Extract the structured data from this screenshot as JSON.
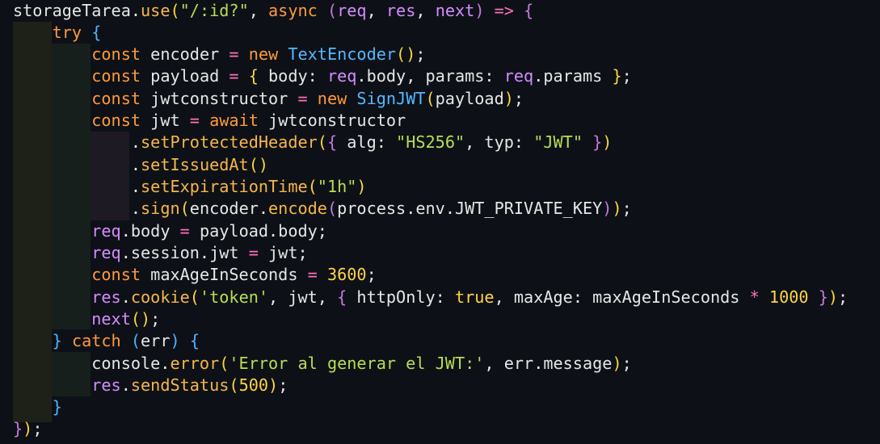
{
  "editor": {
    "language": "javascript",
    "theme_colors": {
      "background": "#0d1117",
      "keyword": "#ff9a3c",
      "function": "#f7b64a",
      "class": "#56b7ff",
      "string": "#b9dd55",
      "number": "#ffd34a",
      "variable": "#d58cff",
      "operator": "#ff6fb7",
      "text": "#e6e6e6"
    },
    "lines": [
      [
        {
          "t": "storageTarea",
          "c": "tx"
        },
        {
          "t": ".",
          "c": "tx"
        },
        {
          "t": "use",
          "c": "fn"
        },
        {
          "t": "(",
          "c": "p1"
        },
        {
          "t": "\"/:id?\"",
          "c": "str"
        },
        {
          "t": ", ",
          "c": "tx"
        },
        {
          "t": "async",
          "c": "kw"
        },
        {
          "t": " ",
          "c": "tx"
        },
        {
          "t": "(",
          "c": "p2"
        },
        {
          "t": "req",
          "c": "var"
        },
        {
          "t": ", ",
          "c": "tx"
        },
        {
          "t": "res",
          "c": "var"
        },
        {
          "t": ", ",
          "c": "tx"
        },
        {
          "t": "next",
          "c": "var"
        },
        {
          "t": ")",
          "c": "p2"
        },
        {
          "t": " => ",
          "c": "op"
        },
        {
          "t": "{",
          "c": "p2"
        }
      ],
      [
        {
          "t": "    ",
          "c": "tx"
        },
        {
          "t": "try",
          "c": "kw"
        },
        {
          "t": " ",
          "c": "tx"
        },
        {
          "t": "{",
          "c": "p3"
        }
      ],
      [
        {
          "t": "        ",
          "c": "tx"
        },
        {
          "t": "const",
          "c": "kw"
        },
        {
          "t": " encoder ",
          "c": "tx"
        },
        {
          "t": "=",
          "c": "op"
        },
        {
          "t": " ",
          "c": "tx"
        },
        {
          "t": "new",
          "c": "kw"
        },
        {
          "t": " ",
          "c": "tx"
        },
        {
          "t": "TextEncoder",
          "c": "cls"
        },
        {
          "t": "()",
          "c": "p1"
        },
        {
          "t": ";",
          "c": "tx"
        }
      ],
      [
        {
          "t": "        ",
          "c": "tx"
        },
        {
          "t": "const",
          "c": "kw"
        },
        {
          "t": " payload ",
          "c": "tx"
        },
        {
          "t": "=",
          "c": "op"
        },
        {
          "t": " ",
          "c": "tx"
        },
        {
          "t": "{",
          "c": "p1"
        },
        {
          "t": " body: ",
          "c": "tx"
        },
        {
          "t": "req",
          "c": "var"
        },
        {
          "t": ".body, params: ",
          "c": "tx"
        },
        {
          "t": "req",
          "c": "var"
        },
        {
          "t": ".params ",
          "c": "tx"
        },
        {
          "t": "}",
          "c": "p1"
        },
        {
          "t": ";",
          "c": "tx"
        }
      ],
      [
        {
          "t": "        ",
          "c": "tx"
        },
        {
          "t": "const",
          "c": "kw"
        },
        {
          "t": " jwtconstructor ",
          "c": "tx"
        },
        {
          "t": "=",
          "c": "op"
        },
        {
          "t": " ",
          "c": "tx"
        },
        {
          "t": "new",
          "c": "kw"
        },
        {
          "t": " ",
          "c": "tx"
        },
        {
          "t": "SignJWT",
          "c": "cls"
        },
        {
          "t": "(",
          "c": "p1"
        },
        {
          "t": "payload",
          "c": "tx"
        },
        {
          "t": ")",
          "c": "p1"
        },
        {
          "t": ";",
          "c": "tx"
        }
      ],
      [
        {
          "t": "        ",
          "c": "tx"
        },
        {
          "t": "const",
          "c": "kw"
        },
        {
          "t": " jwt ",
          "c": "tx"
        },
        {
          "t": "=",
          "c": "op"
        },
        {
          "t": " ",
          "c": "tx"
        },
        {
          "t": "await",
          "c": "kw"
        },
        {
          "t": " jwtconstructor",
          "c": "tx"
        }
      ],
      [
        {
          "t": "            ",
          "c": "tx"
        },
        {
          "t": ".",
          "c": "tx"
        },
        {
          "t": "setProtectedHeader",
          "c": "fn"
        },
        {
          "t": "(",
          "c": "p1"
        },
        {
          "t": "{",
          "c": "p2"
        },
        {
          "t": " alg: ",
          "c": "tx"
        },
        {
          "t": "\"HS256\"",
          "c": "str"
        },
        {
          "t": ", typ: ",
          "c": "tx"
        },
        {
          "t": "\"JWT\"",
          "c": "str"
        },
        {
          "t": " ",
          "c": "tx"
        },
        {
          "t": "}",
          "c": "p2"
        },
        {
          "t": ")",
          "c": "p1"
        }
      ],
      [
        {
          "t": "            ",
          "c": "tx"
        },
        {
          "t": ".",
          "c": "tx"
        },
        {
          "t": "setIssuedAt",
          "c": "fn"
        },
        {
          "t": "()",
          "c": "p1"
        }
      ],
      [
        {
          "t": "            ",
          "c": "tx"
        },
        {
          "t": ".",
          "c": "tx"
        },
        {
          "t": "setExpirationTime",
          "c": "fn"
        },
        {
          "t": "(",
          "c": "p1"
        },
        {
          "t": "\"1h\"",
          "c": "str"
        },
        {
          "t": ")",
          "c": "p1"
        }
      ],
      [
        {
          "t": "            ",
          "c": "tx"
        },
        {
          "t": ".",
          "c": "tx"
        },
        {
          "t": "sign",
          "c": "fn"
        },
        {
          "t": "(",
          "c": "p1"
        },
        {
          "t": "encoder.",
          "c": "tx"
        },
        {
          "t": "encode",
          "c": "fn"
        },
        {
          "t": "(",
          "c": "p2"
        },
        {
          "t": "process.env.JWT_PRIVATE_KEY",
          "c": "tx"
        },
        {
          "t": ")",
          "c": "p2"
        },
        {
          "t": ")",
          "c": "p1"
        },
        {
          "t": ";",
          "c": "tx"
        }
      ],
      [
        {
          "t": "        ",
          "c": "tx"
        },
        {
          "t": "req",
          "c": "var"
        },
        {
          "t": ".body ",
          "c": "tx"
        },
        {
          "t": "=",
          "c": "op"
        },
        {
          "t": " payload.body;",
          "c": "tx"
        }
      ],
      [
        {
          "t": "        ",
          "c": "tx"
        },
        {
          "t": "req",
          "c": "var"
        },
        {
          "t": ".session.jwt ",
          "c": "tx"
        },
        {
          "t": "=",
          "c": "op"
        },
        {
          "t": " jwt;",
          "c": "tx"
        }
      ],
      [
        {
          "t": "        ",
          "c": "tx"
        },
        {
          "t": "const",
          "c": "kw"
        },
        {
          "t": " maxAgeInSeconds ",
          "c": "tx"
        },
        {
          "t": "=",
          "c": "op"
        },
        {
          "t": " ",
          "c": "tx"
        },
        {
          "t": "3600",
          "c": "num"
        },
        {
          "t": ";",
          "c": "tx"
        }
      ],
      [
        {
          "t": "        ",
          "c": "tx"
        },
        {
          "t": "res",
          "c": "var"
        },
        {
          "t": ".",
          "c": "tx"
        },
        {
          "t": "cookie",
          "c": "fn"
        },
        {
          "t": "(",
          "c": "p1"
        },
        {
          "t": "'token'",
          "c": "str"
        },
        {
          "t": ", jwt, ",
          "c": "tx"
        },
        {
          "t": "{",
          "c": "p2"
        },
        {
          "t": " httpOnly: ",
          "c": "tx"
        },
        {
          "t": "true",
          "c": "num"
        },
        {
          "t": ", maxAge: maxAgeInSeconds ",
          "c": "tx"
        },
        {
          "t": "*",
          "c": "op"
        },
        {
          "t": " ",
          "c": "tx"
        },
        {
          "t": "1000",
          "c": "num"
        },
        {
          "t": " ",
          "c": "tx"
        },
        {
          "t": "}",
          "c": "p2"
        },
        {
          "t": ")",
          "c": "p1"
        },
        {
          "t": ";",
          "c": "tx"
        }
      ],
      [
        {
          "t": "        ",
          "c": "tx"
        },
        {
          "t": "next",
          "c": "var"
        },
        {
          "t": "()",
          "c": "p1"
        },
        {
          "t": ";",
          "c": "tx"
        }
      ],
      [
        {
          "t": "    ",
          "c": "tx"
        },
        {
          "t": "}",
          "c": "p3"
        },
        {
          "t": " ",
          "c": "tx"
        },
        {
          "t": "catch",
          "c": "kw"
        },
        {
          "t": " ",
          "c": "tx"
        },
        {
          "t": "(",
          "c": "p3"
        },
        {
          "t": "err",
          "c": "tx"
        },
        {
          "t": ")",
          "c": "p3"
        },
        {
          "t": " ",
          "c": "tx"
        },
        {
          "t": "{",
          "c": "p3"
        }
      ],
      [
        {
          "t": "        ",
          "c": "tx"
        },
        {
          "t": "console.",
          "c": "tx"
        },
        {
          "t": "error",
          "c": "fn"
        },
        {
          "t": "(",
          "c": "p1"
        },
        {
          "t": "'Error al generar el JWT:'",
          "c": "str"
        },
        {
          "t": ", err.message",
          "c": "tx"
        },
        {
          "t": ")",
          "c": "p1"
        },
        {
          "t": ";",
          "c": "tx"
        }
      ],
      [
        {
          "t": "        ",
          "c": "tx"
        },
        {
          "t": "res",
          "c": "var"
        },
        {
          "t": ".",
          "c": "tx"
        },
        {
          "t": "sendStatus",
          "c": "fn"
        },
        {
          "t": "(",
          "c": "p1"
        },
        {
          "t": "500",
          "c": "num"
        },
        {
          "t": ")",
          "c": "p1"
        },
        {
          "t": ";",
          "c": "tx"
        }
      ],
      [
        {
          "t": "    ",
          "c": "tx"
        },
        {
          "t": "}",
          "c": "p3"
        }
      ],
      [
        {
          "t": "}",
          "c": "p2"
        },
        {
          "t": ")",
          "c": "p1"
        },
        {
          "t": ";",
          "c": "tx"
        }
      ]
    ]
  }
}
